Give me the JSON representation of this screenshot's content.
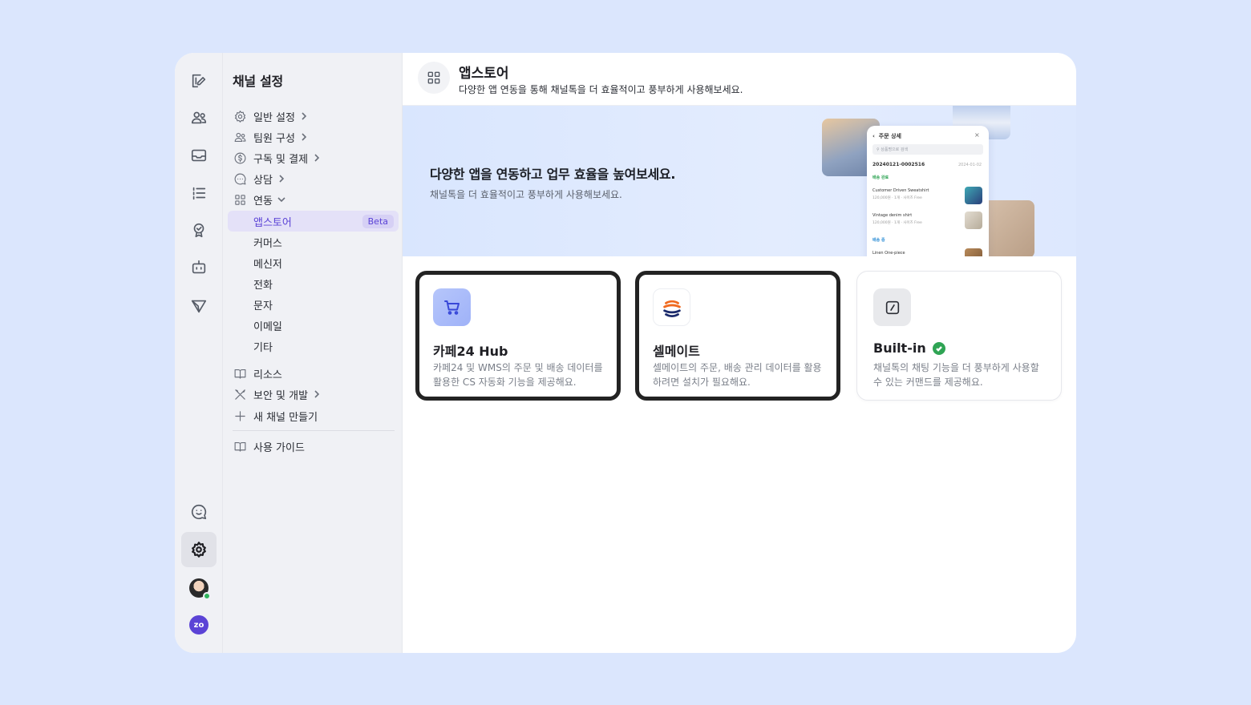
{
  "sidebar": {
    "title": "채널 설정",
    "items": [
      {
        "label": "일반 설정"
      },
      {
        "label": "팀원 구성"
      },
      {
        "label": "구독 및 결제"
      },
      {
        "label": "상담"
      },
      {
        "label": "연동"
      },
      {
        "label": "앱스토어",
        "badge": "Beta"
      },
      {
        "label": "커머스"
      },
      {
        "label": "메신저"
      },
      {
        "label": "전화"
      },
      {
        "label": "문자"
      },
      {
        "label": "이메일"
      },
      {
        "label": "기타"
      },
      {
        "label": "리소스"
      },
      {
        "label": "보안 및 개발"
      },
      {
        "label": "새 채널 만들기"
      },
      {
        "label": "사용 가이드"
      }
    ]
  },
  "header": {
    "title": "앱스토어",
    "subtitle": "다양한 앱 연동을 통해 채널톡을 더 효율적이고 풍부하게 사용해보세요."
  },
  "banner": {
    "title": "다양한 앱을 연동하고 업무 효율을 높여보세요.",
    "subtitle": "채널톡을 더 효율적이고 풍부하게 사용해보세요.",
    "phone": {
      "title": "주문 상세",
      "search": "상품명으로 검색",
      "order_id": "20240121-0002516",
      "date": "2024-01-02",
      "status1": "배송 완료",
      "p1_name": "Customer Driven Sweatshirt",
      "p1_meta": "120,000원 · 1개 · 사이즈 Free",
      "p2_name": "Vintage denim shirt",
      "p2_meta": "120,000원 · 1개 · 사이즈 Free",
      "status2": "배송 중",
      "p3_name": "Linen One-piece"
    }
  },
  "apps": [
    {
      "name": "카페24 Hub",
      "desc": "카페24 및 WMS의 주문 및 배송 데이터를 활용한 CS 자동화 기능을 제공해요.",
      "icon": "cart-icon"
    },
    {
      "name": "셀메이트",
      "desc": "셀메이트의 주문, 배송 관리 데이터를 활용하려면 설치가 필요해요.",
      "icon": "sellmate-logo"
    },
    {
      "name": "Built-in",
      "desc": "채널톡의 채팅 기능을 더 풍부하게 사용할 수 있는 커맨드를 제공해요.",
      "icon": "slash-command-icon",
      "status": "installed"
    }
  ],
  "colors": {
    "accent": "#5b43d6",
    "installed": "#2fa454",
    "background": "#dbe6fd"
  }
}
